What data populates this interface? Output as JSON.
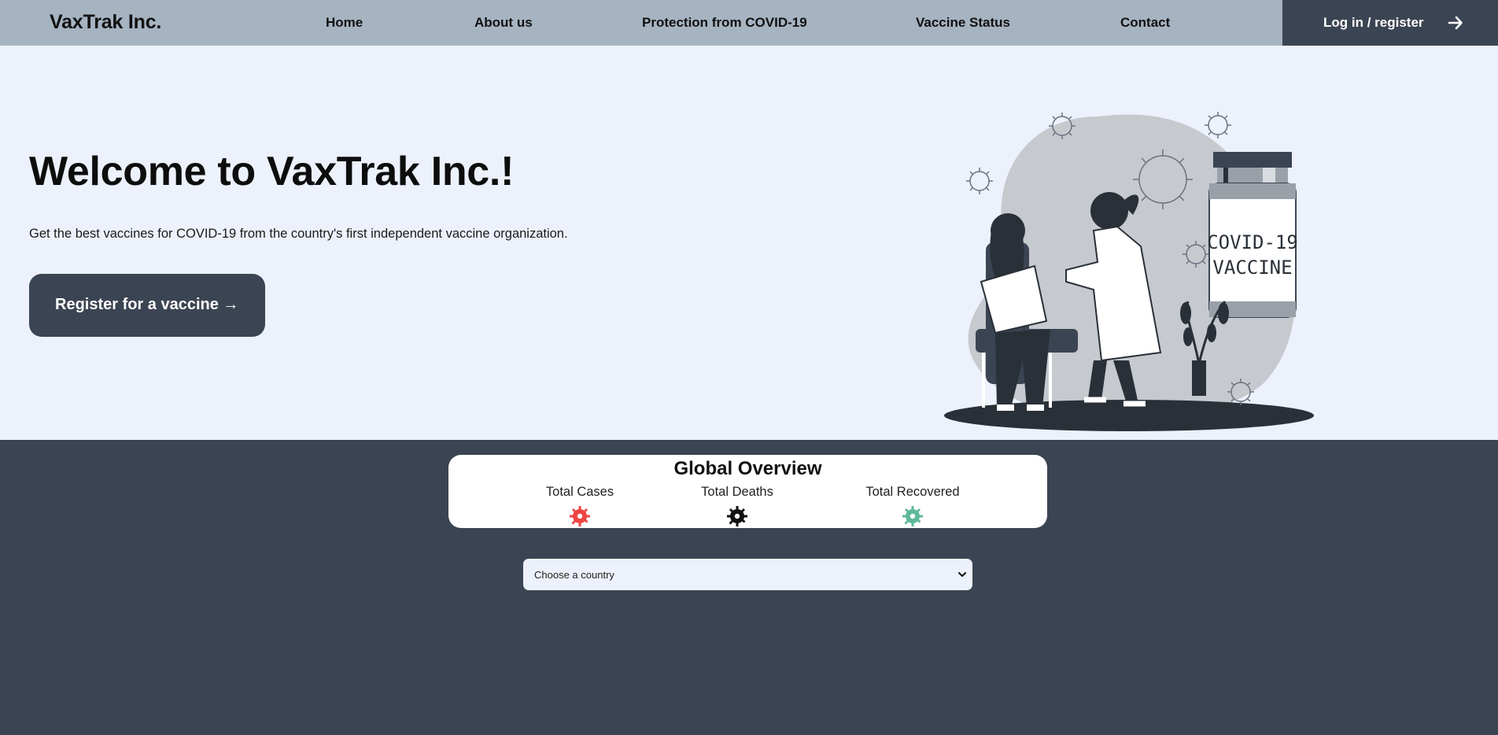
{
  "nav": {
    "brand": "VaxTrak Inc.",
    "links": [
      "Home",
      "About us",
      "Protection from COVID-19",
      "Vaccine Status",
      "Contact"
    ],
    "login_label": "Log in / register",
    "login_icon": "arrow-right-icon"
  },
  "hero": {
    "title": "Welcome to VaxTrak Inc.!",
    "subtitle": "Get the best vaccines for COVID-19 from the country's first independent vaccine organization.",
    "cta_label": "Register for a vaccine →",
    "illustration_text_line1": "COVID-19",
    "illustration_text_line2": "VACCINE"
  },
  "overview": {
    "title": "Global Overview",
    "stats": [
      {
        "label": "Total Cases",
        "icon": "virus-icon",
        "color": "#ef4444"
      },
      {
        "label": "Total Deaths",
        "icon": "virus-icon",
        "color": "#111111"
      },
      {
        "label": "Total Recovered",
        "icon": "virus-icon",
        "color": "#5fb998"
      }
    ]
  },
  "country_select": {
    "selected": "Choose a country"
  },
  "colors": {
    "nav_bg": "#a6b3c1",
    "dark": "#3b4452",
    "hero_bg": "#ecf1fb"
  }
}
